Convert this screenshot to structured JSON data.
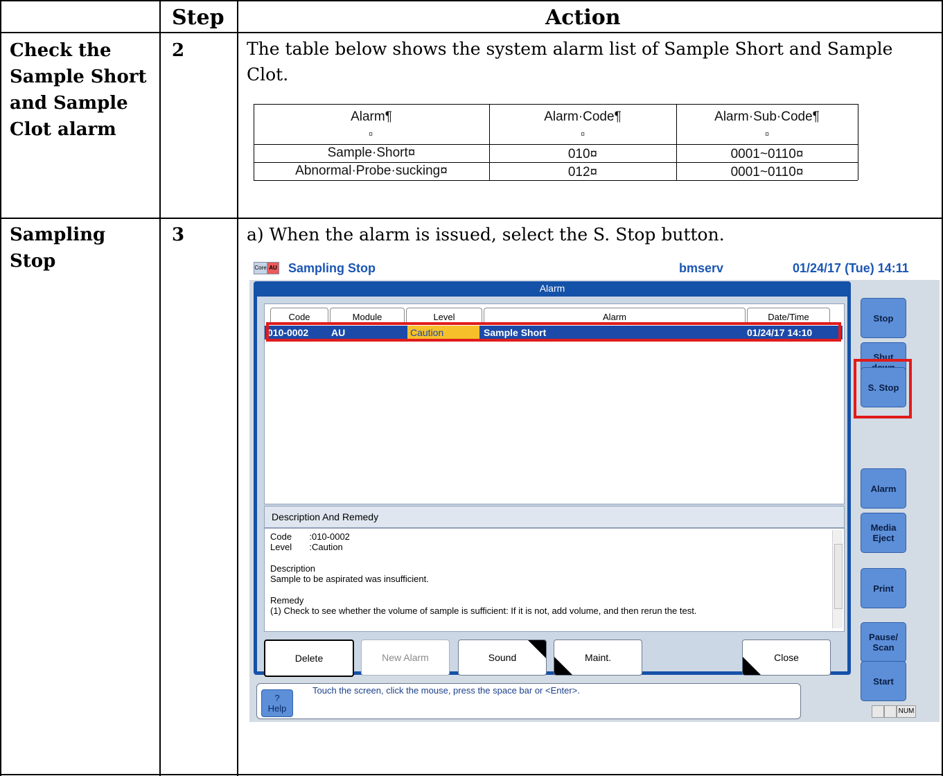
{
  "header": {
    "step": "Step",
    "action": "Action"
  },
  "rows": [
    {
      "section": [
        "Check the",
        "Sample Short",
        "and Sample",
        "Clot alarm"
      ],
      "step": "2",
      "action": [
        "The table below shows the system alarm list of Sample Short and Sample",
        "Clot."
      ]
    },
    {
      "section": [
        "Sampling",
        "Stop"
      ],
      "step": "3",
      "action": [
        "a) When the alarm is issued, select the S. Stop button."
      ]
    }
  ],
  "alarm_table": {
    "headers": [
      "Alarm¶",
      "Alarm·Code¶",
      "Alarm·Sub·Code¶"
    ],
    "header_marks": [
      "¤",
      "¤",
      "¤"
    ],
    "rows": [
      [
        "Sample·Short¤",
        "010¤",
        "0001~0110¤"
      ],
      [
        "Abnormal·Probe·sucking¤",
        "012¤",
        "0001~0110¤"
      ]
    ]
  },
  "screen": {
    "core": "Core",
    "au": "AU",
    "title": "Sampling Stop",
    "user": "bmserv",
    "datetime": "01/24/17 (Tue) 14:11",
    "panel_title": "Alarm",
    "columns": [
      "Code",
      "Module",
      "Level",
      "Alarm",
      "Date/Time"
    ],
    "alarm_row": {
      "code": "010-0002",
      "module": "AU",
      "level": "Caution",
      "alarm": "Sample Short",
      "datetime": "01/24/17  14:10"
    },
    "description_title": "Description And Remedy",
    "description_lines": [
      "Code       :010-0002",
      "Level       :Caution",
      "",
      "Description",
      "Sample to be aspirated was insufficient.",
      "",
      "Remedy",
      "(1) Check to see whether the volume of sample is sufficient: If it is not, add volume, and then rerun the test."
    ],
    "buttons": {
      "delete": "Delete",
      "new_alarm": "New Alarm",
      "sound": "Sound",
      "maint": "Maint.",
      "close": "Close"
    },
    "help": {
      "q": "?",
      "label": "Help",
      "message": "Touch the screen, click the mouse, press the space bar or <Enter>."
    },
    "side_buttons": {
      "stop": "Stop",
      "shutdown": [
        "Shut",
        "down"
      ],
      "sstop": "S. Stop",
      "alarm": "Alarm",
      "media": [
        "Media",
        "Eject"
      ],
      "print": "Print",
      "pause": [
        "Pause/",
        "Scan"
      ],
      "start": "Start"
    },
    "num": "NUM",
    "colors": {
      "title_blue": "#1a56b4",
      "panel_blue": "#1451a8",
      "selected_row": "#1b4aa8",
      "caution": "#f6c02b",
      "highlight_red": "#e01b1b"
    }
  }
}
